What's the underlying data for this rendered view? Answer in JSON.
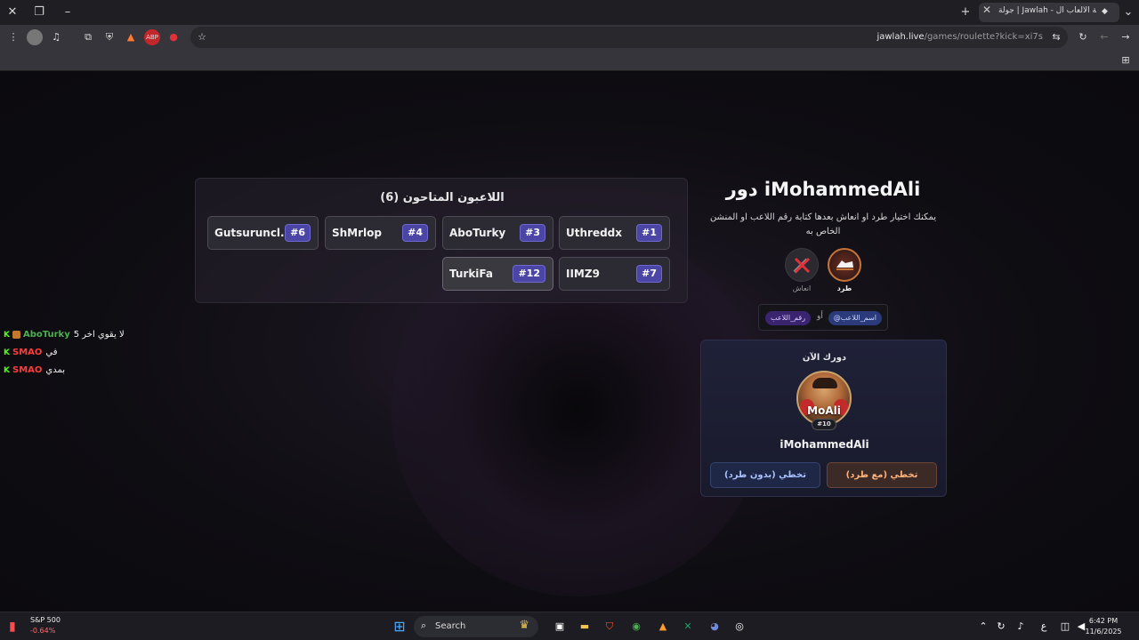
{
  "browser": {
    "tab_title": "جولة | Jawlah - منصة الألعاب ال...",
    "url_host": "jawlah.live",
    "url_path": "/games/roulette?kick=xi7s"
  },
  "players_panel": {
    "title": "اللاعبون المتاحون (6)",
    "players": [
      {
        "name": "Uthreddx",
        "num": "#1"
      },
      {
        "name": "AboTurky",
        "num": "#3"
      },
      {
        "name": "ShMrlop",
        "num": "#4"
      },
      {
        "name": "Gutsuruncl...",
        "num": "#6"
      },
      {
        "name": "IIMZ9",
        "num": "#7"
      },
      {
        "name": "TurkiFa",
        "num": "#12"
      }
    ]
  },
  "turn": {
    "title": "دور iMohammedAli",
    "instructions": "يمكنك اختيار طرد او انعاش بعدها كتابة رقم اللاعب او المنشن الخاص به",
    "kick_label": "طرد",
    "revive_label": "انعاش",
    "hint_name": "@اسم_اللاعب",
    "hint_or": "أو",
    "hint_num": "رقم_اللاعب"
  },
  "current": {
    "label": "دورك الآن",
    "avatar_text": "MoAli",
    "badge": "#10",
    "name": "iMohammedAli",
    "skip_with_kick": "تخطي (مع طرد)",
    "skip_no_kick": "تخطي (بدون طرد)"
  },
  "chat": [
    {
      "user": "AboTurky",
      "msg": "لا يقوي اخر 5",
      "color": "#4caf50",
      "badge": true
    },
    {
      "user": "SMAO",
      "msg": "في",
      "color": "#ff3b3b",
      "badge": false
    },
    {
      "user": "SMAO",
      "msg": "بمدي",
      "color": "#ff3b3b",
      "badge": false
    }
  ],
  "taskbar": {
    "stock_name": "S&P 500",
    "stock_change": "-0.64%",
    "search": "Search",
    "time": "6:42 PM",
    "date": "11/6/2025"
  }
}
